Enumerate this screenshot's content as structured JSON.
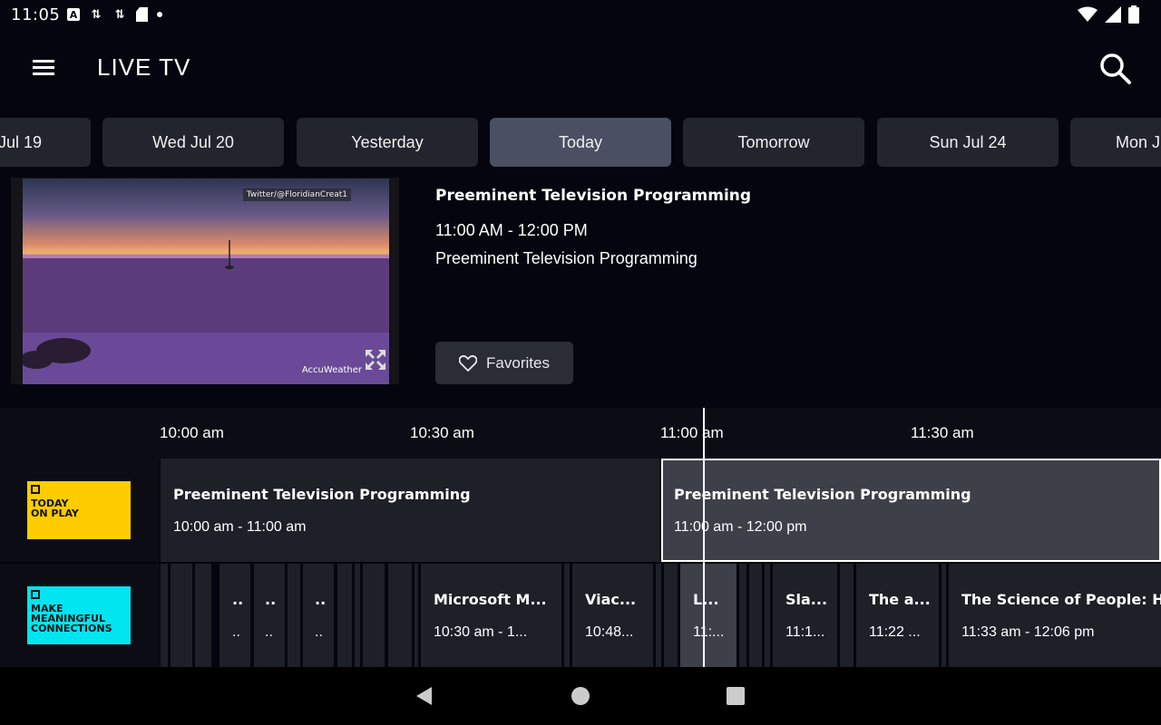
{
  "status": {
    "time": "11:05"
  },
  "app": {
    "title": "LIVE TV"
  },
  "dates": [
    "Jul 19",
    "Wed Jul 20",
    "Yesterday",
    "Today",
    "Tomorrow",
    "Sun Jul 24",
    "Mon J"
  ],
  "preview": {
    "watermark": "Twitter/@FloridianCreat1",
    "brand": "AccuWeather"
  },
  "info": {
    "title": "Preeminent Television Programming",
    "time": "11:00 AM - 12:00 PM",
    "desc": "Preeminent Television Programming",
    "favorites_label": "Favorites"
  },
  "timeline": [
    "10:00 am",
    "10:30 am",
    "11:00 am",
    "11:30 am"
  ],
  "channels": [
    {
      "logo_text": "TODAY\nON PLAY",
      "logo_color": "#ffcc00",
      "programs": [
        {
          "title": "Preeminent Television Programming",
          "time": "10:00 am - 11:00 am"
        },
        {
          "title": "Preeminent Television Programming",
          "time": "11:00 am - 12:00 pm"
        }
      ]
    },
    {
      "logo_text": "MAKE\nMEANINGFUL\nCONNECTIONS",
      "logo_color": "#00e5f0",
      "programs": [
        {
          "title": "..",
          "time": ".."
        },
        {
          "title": "..",
          "time": ".."
        },
        {
          "title": "..",
          "time": ".."
        },
        {
          "title": "Microsoft M...",
          "time": "10:30 am - 1..."
        },
        {
          "title": "Viac...",
          "time": "10:48..."
        },
        {
          "title": "L...",
          "time": "11:..."
        },
        {
          "title": "Sla...",
          "time": "11:1..."
        },
        {
          "title": "The a...",
          "time": "11:22 ..."
        },
        {
          "title": "The Science of People: H",
          "time": "11:33 am - 12:06 pm"
        }
      ]
    }
  ]
}
